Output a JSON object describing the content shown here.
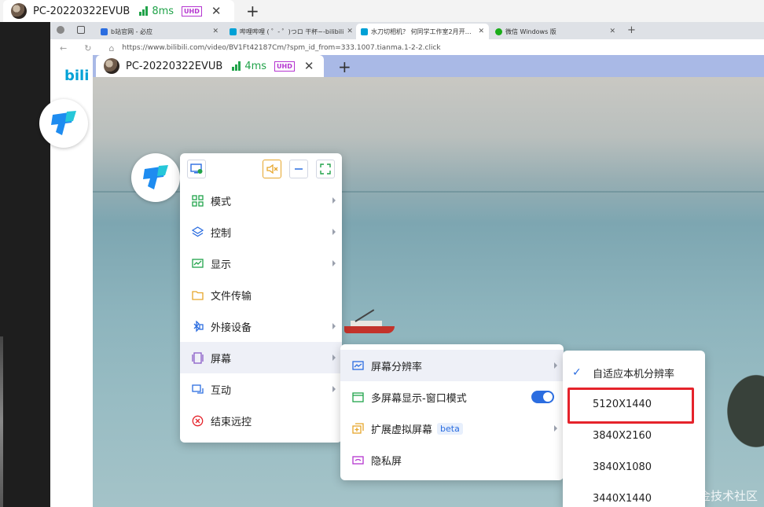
{
  "outer_tab": {
    "title": "PC-20220322EVUB",
    "ping": "8ms",
    "badge": "UHD"
  },
  "browser": {
    "tabs": [
      {
        "label": "b站官网 - 必应",
        "color": "#2b6de0"
      },
      {
        "label": "哔哩哔哩 ( ゜- ゜)つロ 干杯~-bilibili",
        "color": "#00a1d6"
      },
      {
        "label": "水刀切相机？ 何同学工作室2月开…",
        "color": "#00a1d6"
      },
      {
        "label": "微信 Windows 版",
        "color": "#1aad19"
      }
    ],
    "url": "https://www.bilibili.com/video/BV1Ft42187Cm/?spm_id_from=333.1007.tianma.1-2-2.click",
    "logo_text": "bili"
  },
  "inner_tab": {
    "title": "PC-20220322EVUB",
    "ping": "4ms",
    "badge": "UHD"
  },
  "main_menu": {
    "items": [
      {
        "label": "模式",
        "icon": "grid-icon",
        "submenu": true
      },
      {
        "label": "控制",
        "icon": "layers-icon",
        "submenu": true
      },
      {
        "label": "显示",
        "icon": "display-icon",
        "submenu": true
      },
      {
        "label": "文件传输",
        "icon": "folder-icon",
        "submenu": false
      },
      {
        "label": "外接设备",
        "icon": "bluetooth-icon",
        "submenu": true
      },
      {
        "label": "屏幕",
        "icon": "screen-icon",
        "submenu": true
      },
      {
        "label": "互动",
        "icon": "chat-icon",
        "submenu": true
      },
      {
        "label": "结束远控",
        "icon": "stop-icon",
        "submenu": false
      }
    ]
  },
  "screen_menu": {
    "items": [
      {
        "label": "屏幕分辨率",
        "icon": "resolution-icon"
      },
      {
        "label": "多屏幕显示-窗口模式",
        "icon": "window-icon",
        "toggle_on": true
      },
      {
        "label": "扩展虚拟屏幕",
        "icon": "extend-icon",
        "badge": "beta"
      },
      {
        "label": "隐私屏",
        "icon": "privacy-icon"
      }
    ]
  },
  "resolution_menu": {
    "items": [
      {
        "label": "自适应本机分辨率",
        "checked": true
      },
      {
        "label": "5120X1440",
        "checked": false
      },
      {
        "label": "3840X2160",
        "checked": false
      },
      {
        "label": "3840X1080",
        "checked": false
      },
      {
        "label": "3440X1440",
        "checked": false
      }
    ]
  },
  "watermark": "@稀土掘金技术社区",
  "colors": {
    "accent": "#2b6de0",
    "highlight": "#e5232b",
    "ping": "#21a34a"
  }
}
